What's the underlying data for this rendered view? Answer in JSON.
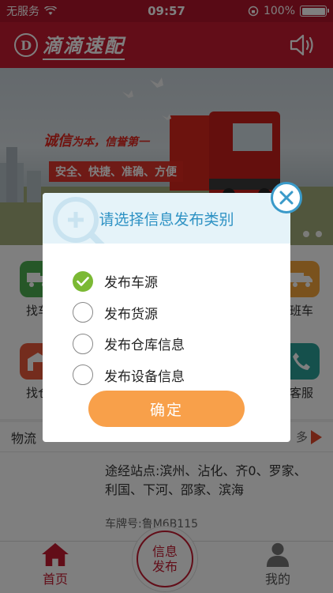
{
  "status_bar": {
    "carrier": "无服务",
    "time": "09:57",
    "battery_text": "100%",
    "battery_level": 1.0
  },
  "header": {
    "logo_letter": "D",
    "logo_text": "滴滴速配"
  },
  "banner": {
    "slogan_main": "诚信",
    "slogan_small": "为本，信誉第一",
    "tags": "安全、快捷、准确、方便",
    "dots": 2
  },
  "grid": {
    "items": [
      {
        "label": "找车",
        "color": "#4caf50",
        "icon": "truck-icon"
      },
      {
        "label": "班车",
        "color": "#f5a43a",
        "icon": "truck-icon"
      },
      {
        "label": "找仓",
        "color": "#e8593a",
        "icon": "warehouse-icon"
      },
      {
        "label": "客服",
        "color": "#2aa198",
        "icon": "phone-icon"
      }
    ]
  },
  "logistics": {
    "title": "物流",
    "more": "多",
    "route": "途经站点:滨州、沾化、齐0、罗家、利国、下河、邵家、滨海",
    "plate": "车牌号:鲁M6B115"
  },
  "tabs": {
    "home": "首页",
    "publish_line1": "信息",
    "publish_line2": "发布",
    "mine": "我的"
  },
  "dialog": {
    "title": "请选择信息发布类别",
    "options": [
      {
        "label": "发布车源",
        "checked": true
      },
      {
        "label": "发布货源",
        "checked": false
      },
      {
        "label": "发布仓库信息",
        "checked": false
      },
      {
        "label": "发布设备信息",
        "checked": false
      }
    ],
    "confirm": "确定"
  },
  "colors": {
    "brand_red": "#c41a30",
    "dialog_blue": "#2e92c4",
    "confirm_orange": "#f8a04a",
    "check_green": "#7bb934"
  }
}
